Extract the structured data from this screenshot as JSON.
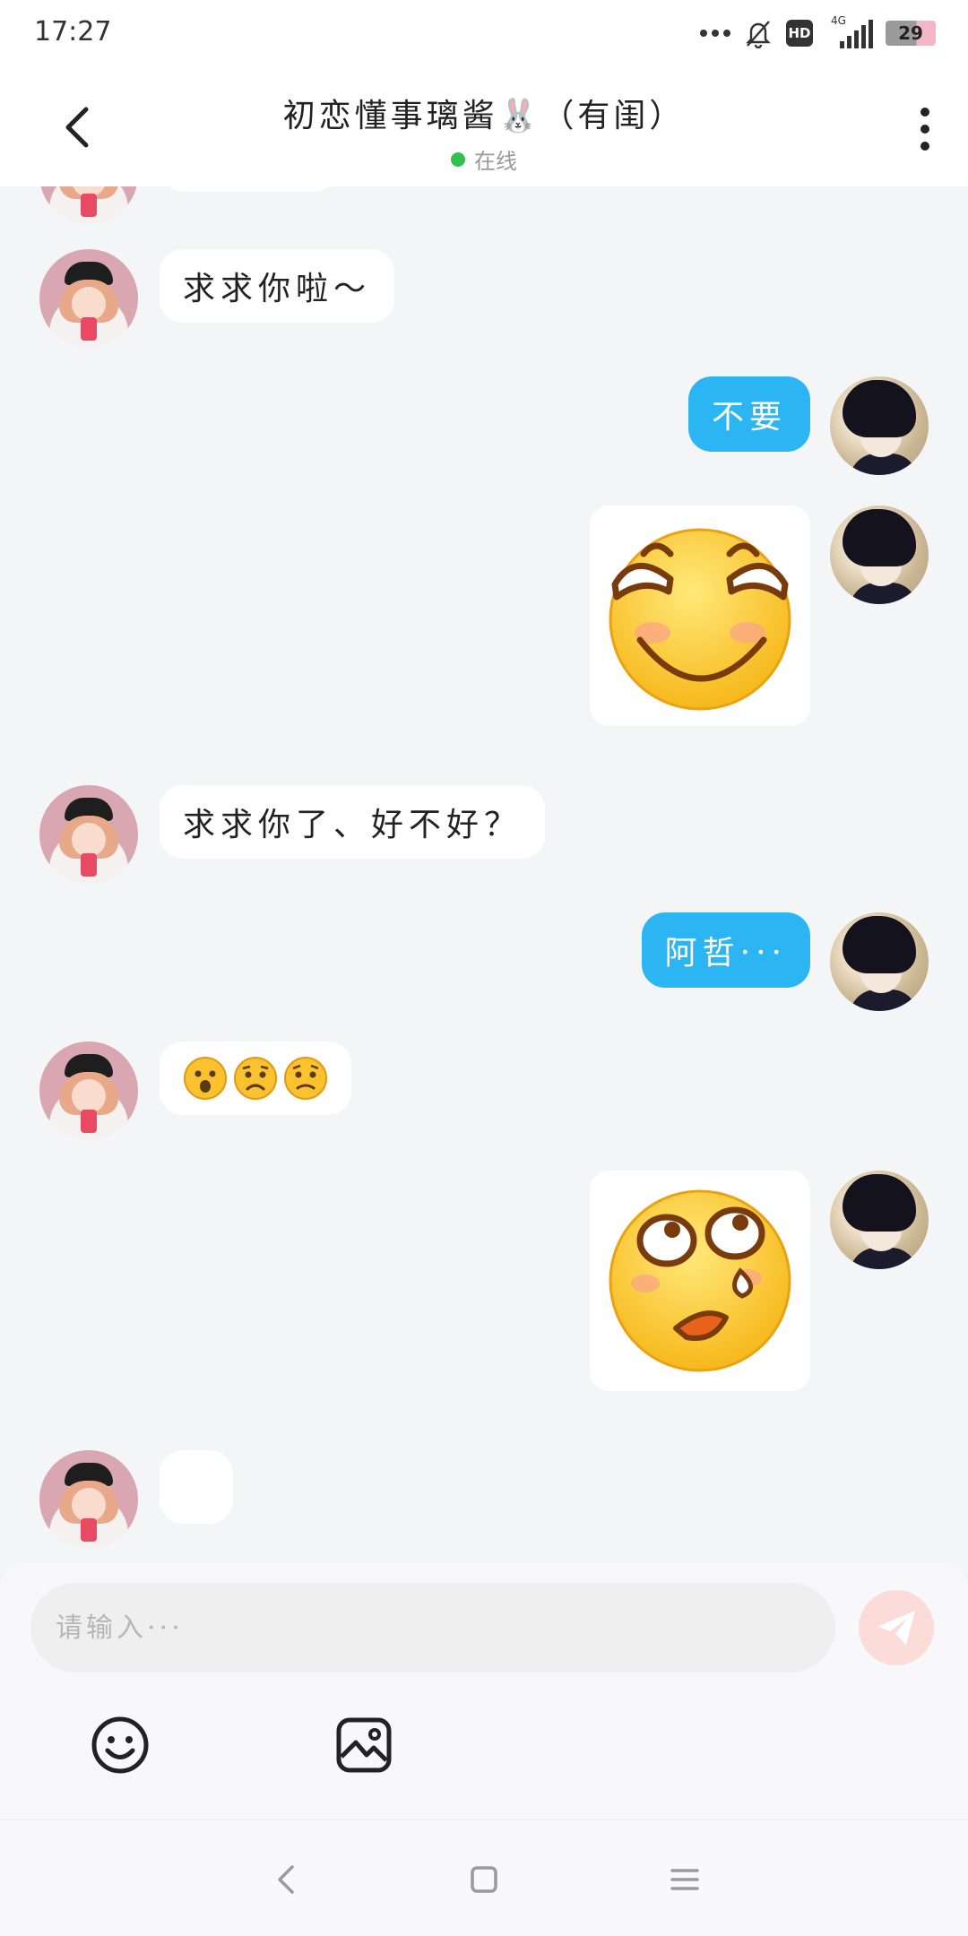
{
  "status_bar": {
    "time": "17:27",
    "network": "4G",
    "hd_label": "HD",
    "battery": "29"
  },
  "header": {
    "title": "初恋懂事璃酱🐰（有闺）",
    "status": "在线"
  },
  "messages": [
    {
      "side": "in",
      "type": "text",
      "text": "求求你啦～"
    },
    {
      "side": "out",
      "type": "text",
      "text": "不要"
    },
    {
      "side": "out",
      "type": "sticker",
      "sticker": "smirk-face-sticker"
    },
    {
      "side": "in",
      "type": "text",
      "text": "求求你了、好不好？"
    },
    {
      "side": "out",
      "type": "text",
      "text": "阿哲···"
    },
    {
      "side": "in",
      "type": "emoji",
      "text": "😮😟😟"
    },
    {
      "side": "out",
      "type": "sticker",
      "sticker": "awkward-sweat-face-sticker"
    },
    {
      "side": "in",
      "type": "text",
      "text": ""
    }
  ],
  "input": {
    "placeholder": "请输入···"
  },
  "icons": {
    "back": "chevron-left-icon",
    "more": "more-vertical-icon",
    "send": "send-icon",
    "emoji": "smiley-icon",
    "image": "image-icon"
  },
  "colors": {
    "outgoing_bubble": "#2cb5f3",
    "online": "#2fc04d",
    "send_button": "#fbdcd9"
  }
}
